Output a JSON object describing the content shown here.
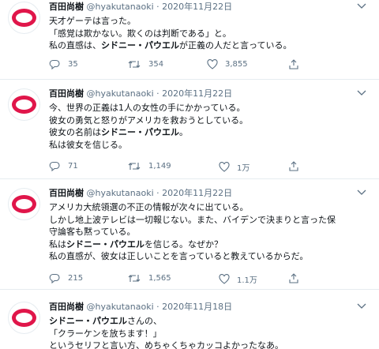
{
  "tweets": [
    {
      "name": "百田尚樹",
      "handle": "@hyakutanaoki · 2020年11月22日",
      "lines": [
        [
          {
            "t": "天才ゲーテは言った。",
            "b": false
          }
        ],
        [
          {
            "t": "「感覚は欺かない。欺くのは判断である」と。",
            "b": false
          }
        ],
        [
          {
            "t": "私の直感は、",
            "b": false
          },
          {
            "t": "シドニー・パウエル",
            "b": true
          },
          {
            "t": "が正義の人だと言っている。",
            "b": false
          }
        ]
      ],
      "reply": "35",
      "retweet": "354",
      "like": "3,855"
    },
    {
      "name": "百田尚樹",
      "handle": "@hyakutanaoki · 2020年11月22日",
      "lines": [
        [
          {
            "t": "今、世界の正義は1人の女性の手にかかっている。",
            "b": false
          }
        ],
        [
          {
            "t": "彼女の勇気と怒りがアメリカを救おうとしている。",
            "b": false
          }
        ],
        [
          {
            "t": "彼女の名前は",
            "b": false
          },
          {
            "t": "シドニー・パウエル",
            "b": true
          },
          {
            "t": "。",
            "b": false
          }
        ],
        [
          {
            "t": "私は彼女を信じる。",
            "b": false
          }
        ]
      ],
      "reply": "71",
      "retweet": "1,149",
      "like": "1万"
    },
    {
      "name": "百田尚樹",
      "handle": "@hyakutanaoki · 2020年11月22日",
      "lines": [
        [
          {
            "t": "アメリカ大統領選の不正の情報が次々に出ている。",
            "b": false
          }
        ],
        [
          {
            "t": "しかし地上波テレビは一切報じない。また、バイデンで決まりと言った保",
            "b": false
          }
        ],
        [
          {
            "t": "守論客も黙っている。",
            "b": false
          }
        ],
        [
          {
            "t": "私は",
            "b": false
          },
          {
            "t": "シドニー・パウエル",
            "b": true
          },
          {
            "t": "を信じる。なぜか？",
            "b": false
          }
        ],
        [
          {
            "t": "私の直感が、彼女は正しいことを言っていると教えているからだ。",
            "b": false
          }
        ]
      ],
      "reply": "215",
      "retweet": "1,565",
      "like": "1.1万"
    },
    {
      "name": "百田尚樹",
      "handle": "@hyakutanaoki · 2020年11月18日",
      "lines": [
        [
          {
            "t": "シドニー・パウエル",
            "b": true
          },
          {
            "t": "さんの、",
            "b": false
          }
        ],
        [
          {
            "t": "「クラーケンを放ちます！」",
            "b": false
          }
        ],
        [
          {
            "t": "というセリフと言い方、めちゃくちゃカッコよかったなあ。",
            "b": false
          }
        ]
      ],
      "reply": "",
      "retweet": "",
      "like": ""
    }
  ],
  "colors": {
    "avatar_ring": "#e0164a",
    "secondary_text": "#5b7083",
    "divider": "#e6ecf0"
  }
}
